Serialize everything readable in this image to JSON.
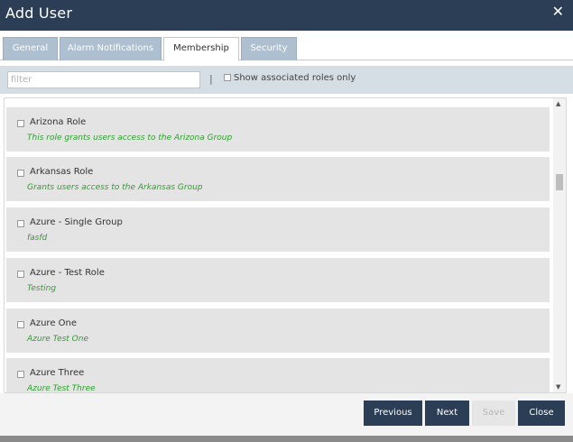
{
  "window": {
    "title": "Add User",
    "close_glyph": "✕"
  },
  "tabs": [
    {
      "label": "General"
    },
    {
      "label": "Alarm Notifications"
    },
    {
      "label": "Membership"
    },
    {
      "label": "Security"
    }
  ],
  "active_tab": "Membership",
  "filter": {
    "placeholder": "filter",
    "separator": "|",
    "associated_label": "Show associated roles only"
  },
  "roles": [
    {
      "name": "Arizona Role",
      "description": "This role grants users access to the Arizona Group"
    },
    {
      "name": "Arkansas Role",
      "description": "Grants users access to the Arkansas Group"
    },
    {
      "name": "Azure - Single Group",
      "description": "fasfd"
    },
    {
      "name": "Azure - Test Role",
      "description": "Testing"
    },
    {
      "name": "Azure One",
      "description": "Azure Test One"
    },
    {
      "name": "Azure Three",
      "description": "Azure Test Three"
    }
  ],
  "buttons": {
    "previous": "Previous",
    "next": "Next",
    "save": "Save",
    "close": "Close"
  },
  "icons": {
    "scroll_up": "▲",
    "scroll_down": "▼"
  },
  "colors": {
    "header": "#2c3e55",
    "role_description": "#2e9e2e",
    "tab_inactive": "#aebfd0"
  }
}
